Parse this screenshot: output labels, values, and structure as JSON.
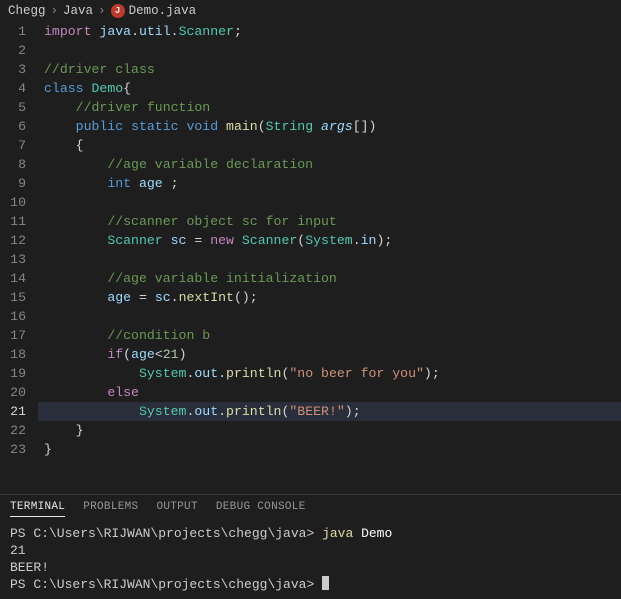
{
  "breadcrumb": {
    "part1": "Chegg",
    "part2": "Java",
    "file": "Demo.java"
  },
  "editor": {
    "current_line": 21,
    "lines": [
      {
        "n": 1,
        "t": [
          [
            "kw",
            "import"
          ],
          [
            "punc",
            " "
          ],
          [
            "var",
            "java"
          ],
          [
            "punc",
            "."
          ],
          [
            "var",
            "util"
          ],
          [
            "punc",
            "."
          ],
          [
            "class",
            "Scanner"
          ],
          [
            "punc",
            ";"
          ]
        ]
      },
      {
        "n": 2,
        "t": []
      },
      {
        "n": 3,
        "t": [
          [
            "comment",
            "//driver class"
          ]
        ]
      },
      {
        "n": 4,
        "t": [
          [
            "mod",
            "class"
          ],
          [
            "punc",
            " "
          ],
          [
            "class",
            "Demo"
          ],
          [
            "punc",
            "{"
          ]
        ]
      },
      {
        "n": 5,
        "t": [
          [
            "punc",
            "    "
          ],
          [
            "comment",
            "//driver function"
          ]
        ]
      },
      {
        "n": 6,
        "t": [
          [
            "punc",
            "    "
          ],
          [
            "mod",
            "public"
          ],
          [
            "punc",
            " "
          ],
          [
            "mod",
            "static"
          ],
          [
            "punc",
            " "
          ],
          [
            "type",
            "void"
          ],
          [
            "punc",
            " "
          ],
          [
            "func",
            "main"
          ],
          [
            "punc",
            "("
          ],
          [
            "class",
            "String"
          ],
          [
            "punc",
            " "
          ],
          [
            "param",
            "args"
          ],
          [
            "punc",
            "[])"
          ]
        ]
      },
      {
        "n": 7,
        "t": [
          [
            "punc",
            "    {"
          ]
        ]
      },
      {
        "n": 8,
        "t": [
          [
            "punc",
            "        "
          ],
          [
            "comment",
            "//age variable declaration"
          ]
        ]
      },
      {
        "n": 9,
        "t": [
          [
            "punc",
            "        "
          ],
          [
            "type",
            "int"
          ],
          [
            "punc",
            " "
          ],
          [
            "var",
            "age"
          ],
          [
            "punc",
            " ;"
          ]
        ]
      },
      {
        "n": 10,
        "t": []
      },
      {
        "n": 11,
        "t": [
          [
            "punc",
            "        "
          ],
          [
            "comment",
            "//scanner object sc for input"
          ]
        ]
      },
      {
        "n": 12,
        "t": [
          [
            "punc",
            "        "
          ],
          [
            "class",
            "Scanner"
          ],
          [
            "punc",
            " "
          ],
          [
            "var",
            "sc"
          ],
          [
            "punc",
            " = "
          ],
          [
            "kw",
            "new"
          ],
          [
            "punc",
            " "
          ],
          [
            "class",
            "Scanner"
          ],
          [
            "punc",
            "("
          ],
          [
            "class",
            "System"
          ],
          [
            "punc",
            "."
          ],
          [
            "field",
            "in"
          ],
          [
            "punc",
            ");"
          ]
        ]
      },
      {
        "n": 13,
        "t": []
      },
      {
        "n": 14,
        "t": [
          [
            "punc",
            "        "
          ],
          [
            "comment",
            "//age variable initialization"
          ]
        ]
      },
      {
        "n": 15,
        "t": [
          [
            "punc",
            "        "
          ],
          [
            "var",
            "age"
          ],
          [
            "punc",
            " = "
          ],
          [
            "var",
            "sc"
          ],
          [
            "punc",
            "."
          ],
          [
            "func",
            "nextInt"
          ],
          [
            "punc",
            "();"
          ]
        ]
      },
      {
        "n": 16,
        "t": []
      },
      {
        "n": 17,
        "t": [
          [
            "punc",
            "        "
          ],
          [
            "comment",
            "//condition b"
          ]
        ]
      },
      {
        "n": 18,
        "t": [
          [
            "punc",
            "        "
          ],
          [
            "kw",
            "if"
          ],
          [
            "punc",
            "("
          ],
          [
            "var",
            "age"
          ],
          [
            "punc",
            "<"
          ],
          [
            "num",
            "21"
          ],
          [
            "punc",
            ")"
          ]
        ]
      },
      {
        "n": 19,
        "t": [
          [
            "punc",
            "            "
          ],
          [
            "class",
            "System"
          ],
          [
            "punc",
            "."
          ],
          [
            "field",
            "out"
          ],
          [
            "punc",
            "."
          ],
          [
            "func",
            "println"
          ],
          [
            "punc",
            "("
          ],
          [
            "str",
            "\"no beer for you\""
          ],
          [
            "punc",
            ");"
          ]
        ]
      },
      {
        "n": 20,
        "t": [
          [
            "punc",
            "        "
          ],
          [
            "kw",
            "else"
          ]
        ]
      },
      {
        "n": 21,
        "t": [
          [
            "punc",
            "            "
          ],
          [
            "class",
            "System"
          ],
          [
            "punc",
            "."
          ],
          [
            "field",
            "out"
          ],
          [
            "punc",
            "."
          ],
          [
            "func",
            "println"
          ],
          [
            "punc",
            "("
          ],
          [
            "str",
            "\"BEER!\""
          ],
          [
            "punc",
            ");"
          ]
        ]
      },
      {
        "n": 22,
        "t": [
          [
            "punc",
            "    }"
          ]
        ]
      },
      {
        "n": 23,
        "t": [
          [
            "punc",
            "}"
          ]
        ]
      }
    ]
  },
  "panel": {
    "tabs": {
      "terminal": "TERMINAL",
      "problems": "PROBLEMS",
      "output": "OUTPUT",
      "debug": "DEBUG CONSOLE"
    },
    "terminal": {
      "line1_prompt": "PS C:\\Users\\RIJWAN\\projects\\chegg\\java> ",
      "line1_cmd": "java ",
      "line1_arg": "Demo",
      "line2": "21",
      "line3": "BEER!",
      "line4_prompt": "PS C:\\Users\\RIJWAN\\projects\\chegg\\java> "
    }
  }
}
